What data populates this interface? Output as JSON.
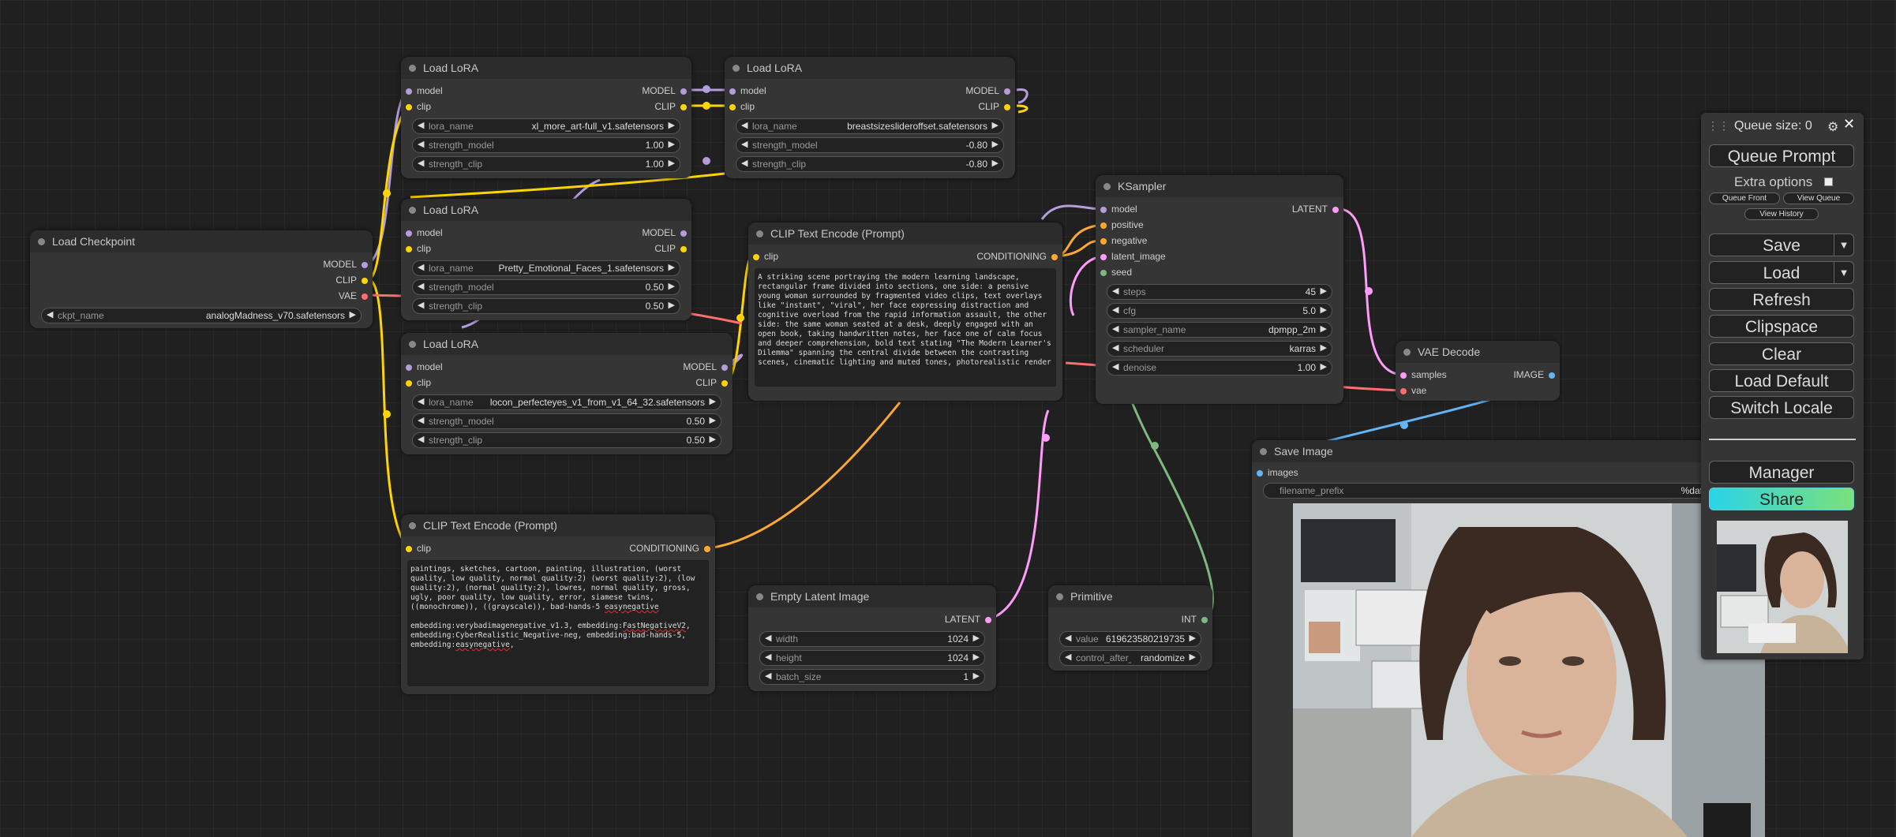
{
  "colors": {
    "model": "#b39ddb",
    "clip": "#ffd500",
    "vae": "#ff6e6e",
    "conditioning": "#ffa931",
    "latent": "#ff9cf9",
    "image": "#64b5f6",
    "int": "#7fb87f",
    "accent_share": "#2fe0d0"
  },
  "nodes": {
    "load_checkpoint": {
      "title": "Load Checkpoint",
      "outputs": [
        "MODEL",
        "CLIP",
        "VAE"
      ],
      "widget": {
        "name": "ckpt_name",
        "value": "analogMadness_v70.safetensors"
      }
    },
    "lora1": {
      "title": "Load LoRA",
      "in_model": "model",
      "in_clip": "clip",
      "out_model": "MODEL",
      "out_clip": "CLIP",
      "widgets": [
        {
          "name": "lora_name",
          "value": "xl_more_art-full_v1.safetensors"
        },
        {
          "name": "strength_model",
          "value": "1.00"
        },
        {
          "name": "strength_clip",
          "value": "1.00"
        }
      ]
    },
    "lora2": {
      "title": "Load LoRA",
      "in_model": "model",
      "in_clip": "clip",
      "out_model": "MODEL",
      "out_clip": "CLIP",
      "widgets": [
        {
          "name": "lora_name",
          "value": "breastsizeslideroffset.safetensors"
        },
        {
          "name": "strength_model",
          "value": "-0.80"
        },
        {
          "name": "strength_clip",
          "value": "-0.80"
        }
      ]
    },
    "lora3": {
      "title": "Load LoRA",
      "in_model": "model",
      "in_clip": "clip",
      "out_model": "MODEL",
      "out_clip": "CLIP",
      "widgets": [
        {
          "name": "lora_name",
          "value": "Pretty_Emotional_Faces_1.safetensors"
        },
        {
          "name": "strength_model",
          "value": "0.50"
        },
        {
          "name": "strength_clip",
          "value": "0.50"
        }
      ]
    },
    "lora4": {
      "title": "Load LoRA",
      "in_model": "model",
      "in_clip": "clip",
      "out_model": "MODEL",
      "out_clip": "CLIP",
      "widgets": [
        {
          "name": "lora_name",
          "value": "locon_perfecteyes_v1_from_v1_64_32.safetensors"
        },
        {
          "name": "strength_model",
          "value": "0.50"
        },
        {
          "name": "strength_clip",
          "value": "0.50"
        }
      ]
    },
    "clip_pos": {
      "title": "CLIP Text Encode (Prompt)",
      "in_clip": "clip",
      "out": "CONDITIONING",
      "text": "A striking scene portraying the modern learning landscape, rectangular frame divided into sections, one side: a pensive young woman surrounded by fragmented video clips, text overlays like \"instant\", \"viral\", her face expressing distraction and cognitive overload from the rapid information assault, the other side: the same woman seated at a desk, deeply engaged with an open book, taking handwritten notes, her face one of calm focus and deeper comprehension, bold text stating \"The Modern Learner's Dilemma\" spanning the central divide between the contrasting scenes, cinematic lighting and muted tones, photorealistic render"
    },
    "clip_neg": {
      "title": "CLIP Text Encode (Prompt)",
      "in_clip": "clip",
      "out": "CONDITIONING",
      "text_1": "paintings, sketches, cartoon, painting, illustration, (worst quality, low quality, normal quality:2) (worst quality:2), (low quality:2), (normal quality:2), lowres, normal quality, gross, ugly, poor quality, low quality, error, siamese twins, ((monochrome)), ((grayscale)), bad-hands-5 ",
      "text_1_squiggle": "easynegative",
      "text_2a": "embedding:verybadimagenegative_v1.3, embedding:",
      "text_2b": "FastNegativeV2",
      "text_2c": ", embedding:CyberRealistic_Negative-neg, embedding:bad-hands-5, embedding:",
      "text_2d": "easynegative",
      "text_2e": ","
    },
    "ksampler": {
      "title": "KSampler",
      "inputs": [
        "model",
        "positive",
        "negative",
        "latent_image",
        "seed"
      ],
      "out": "LATENT",
      "widgets": [
        {
          "name": "steps",
          "value": "45"
        },
        {
          "name": "cfg",
          "value": "5.0"
        },
        {
          "name": "sampler_name",
          "value": "dpmpp_2m"
        },
        {
          "name": "scheduler",
          "value": "karras"
        },
        {
          "name": "denoise",
          "value": "1.00"
        }
      ]
    },
    "vae_decode": {
      "title": "VAE Decode",
      "in_samples": "samples",
      "in_vae": "vae",
      "out": "IMAGE"
    },
    "empty_latent": {
      "title": "Empty Latent Image",
      "out": "LATENT",
      "widgets": [
        {
          "name": "width",
          "value": "1024"
        },
        {
          "name": "height",
          "value": "1024"
        },
        {
          "name": "batch_size",
          "value": "1"
        }
      ]
    },
    "primitive": {
      "title": "Primitive",
      "out": "INT",
      "widgets": [
        {
          "name": "value",
          "value": "619623580219735"
        },
        {
          "name": "control_after_generate",
          "value": "randomize"
        }
      ]
    },
    "save_image": {
      "title": "Save Image",
      "in_images": "images",
      "widget": {
        "name": "filename_prefix",
        "value": "%dat"
      }
    }
  },
  "menu": {
    "queue_size": "Queue size: 0",
    "queue_prompt": "Queue Prompt",
    "extra_options": "Extra options",
    "queue_front": "Queue Front",
    "view_queue": "View Queue",
    "view_history": "View History",
    "save": "Save",
    "load": "Load",
    "refresh": "Refresh",
    "clipspace": "Clipspace",
    "clear": "Clear",
    "load_default": "Load Default",
    "switch_locale": "Switch Locale",
    "manager": "Manager",
    "share": "Share"
  }
}
